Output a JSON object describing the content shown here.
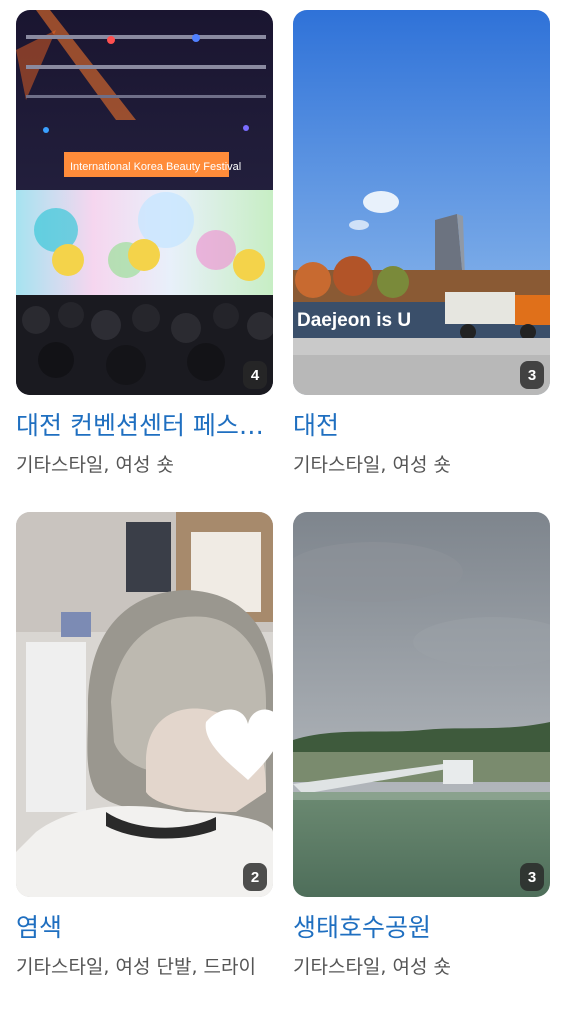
{
  "cards": [
    {
      "title": "대전 컨벤션센터 페스티벌",
      "tags": "기타스타일, 여성 숏",
      "photo_count": "4",
      "image_text": "International Korea Beauty Festival"
    },
    {
      "title": "대전",
      "tags": "기타스타일, 여성 숏",
      "photo_count": "3",
      "image_text": "Daejeon is U"
    },
    {
      "title": "염색",
      "tags": "기타스타일, 여성 단발, 드라이",
      "photo_count": "2"
    },
    {
      "title": "생태호수공원",
      "tags": "기타스타일, 여성 숏",
      "photo_count": "3"
    }
  ],
  "colors": {
    "title": "#1f6fc0",
    "tags": "#555555",
    "badge_bg": "#282828"
  }
}
